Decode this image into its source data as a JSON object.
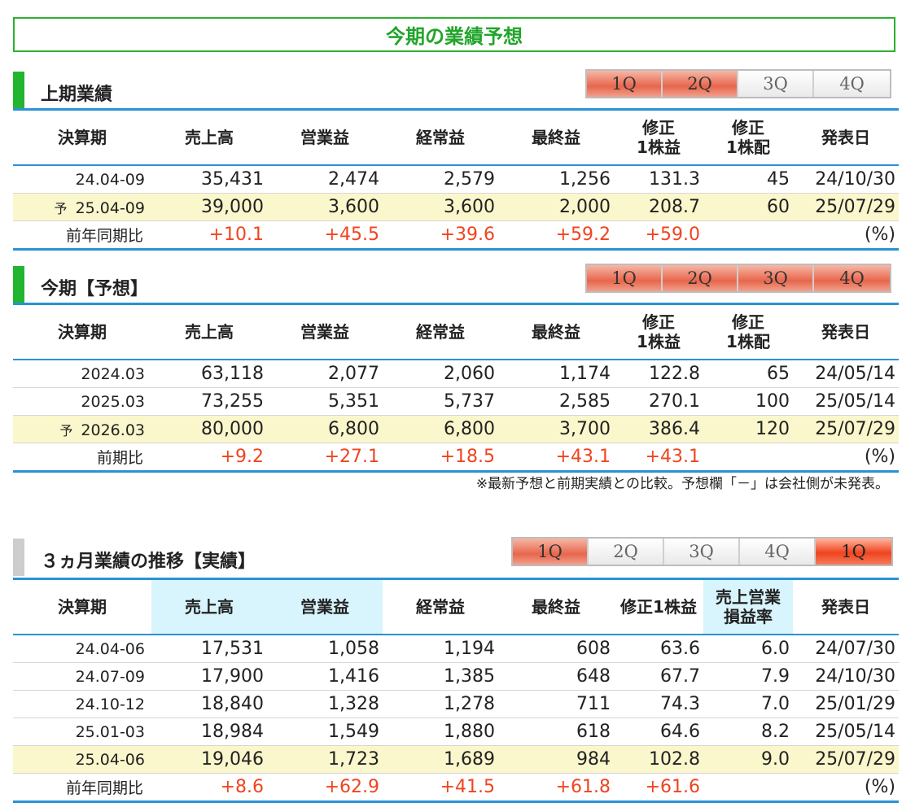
{
  "banner": "今期の業績予想",
  "first_half": {
    "title": "上期業績",
    "tabs": [
      "1Q",
      "2Q",
      "3Q",
      "4Q"
    ],
    "headers": [
      "決算期",
      "売上高",
      "営業益",
      "経常益",
      "最終益",
      "修正\n1株益",
      "修正\n1株配",
      "発表日"
    ],
    "rows": [
      {
        "period": "24.04-09",
        "forecast": false,
        "values": [
          "35,431",
          "2,474",
          "2,579",
          "1,256",
          "131.3",
          "45",
          "24/10/30"
        ]
      },
      {
        "period": "25.04-09",
        "forecast": true,
        "mark": "予",
        "values": [
          "39,000",
          "3,600",
          "3,600",
          "2,000",
          "208.7",
          "60",
          "25/07/29"
        ]
      }
    ],
    "compare": {
      "label": "前年同期比",
      "values": [
        "+10.1",
        "+45.5",
        "+39.6",
        "+59.2",
        "+59.0",
        "",
        "(%)"
      ]
    }
  },
  "full_year": {
    "title": "今期【予想】",
    "tabs": [
      "1Q",
      "2Q",
      "3Q",
      "4Q"
    ],
    "headers": [
      "決算期",
      "売上高",
      "営業益",
      "経常益",
      "最終益",
      "修正\n1株益",
      "修正\n1株配",
      "発表日"
    ],
    "rows": [
      {
        "period": "2024.03",
        "forecast": false,
        "values": [
          "63,118",
          "2,077",
          "2,060",
          "1,174",
          "122.8",
          "65",
          "24/05/14"
        ]
      },
      {
        "period": "2025.03",
        "forecast": false,
        "values": [
          "73,255",
          "5,351",
          "5,737",
          "2,585",
          "270.1",
          "100",
          "25/05/14"
        ]
      },
      {
        "period": "2026.03",
        "forecast": true,
        "mark": "予",
        "values": [
          "80,000",
          "6,800",
          "6,800",
          "3,700",
          "386.4",
          "120",
          "25/07/29"
        ]
      }
    ],
    "compare": {
      "label": "前期比",
      "values": [
        "+9.2",
        "+27.1",
        "+18.5",
        "+43.1",
        "+43.1",
        "",
        "(%)"
      ]
    },
    "note": "※最新予想と前期実績との比較。予想欄「－」は会社側が未発表。"
  },
  "quarterly": {
    "title": "３ヵ月業績の推移【実績】",
    "tabs": [
      "1Q",
      "2Q",
      "3Q",
      "4Q",
      "1Q"
    ],
    "headers": [
      "決算期",
      "売上高",
      "営業益",
      "経常益",
      "最終益",
      "修正1株益",
      "売上営業\n損益率",
      "発表日"
    ],
    "rows": [
      {
        "period": "24.04-06",
        "forecast": false,
        "values": [
          "17,531",
          "1,058",
          "1,194",
          "608",
          "63.6",
          "6.0",
          "24/07/30"
        ]
      },
      {
        "period": "24.07-09",
        "forecast": false,
        "values": [
          "17,900",
          "1,416",
          "1,385",
          "648",
          "67.7",
          "7.9",
          "24/10/30"
        ]
      },
      {
        "period": "24.10-12",
        "forecast": false,
        "values": [
          "18,840",
          "1,328",
          "1,278",
          "711",
          "74.3",
          "7.0",
          "25/01/29"
        ]
      },
      {
        "period": "25.01-03",
        "forecast": false,
        "values": [
          "18,984",
          "1,549",
          "1,880",
          "618",
          "64.6",
          "8.2",
          "25/05/14"
        ]
      },
      {
        "period": "25.04-06",
        "forecast": false,
        "highlight": true,
        "values": [
          "19,046",
          "1,723",
          "1,689",
          "984",
          "102.8",
          "9.0",
          "25/07/29"
        ]
      }
    ],
    "compare": {
      "label": "前年同期比",
      "values": [
        "+8.6",
        "+62.9",
        "+41.5",
        "+61.8",
        "+61.6",
        "",
        "(%)"
      ]
    }
  },
  "colors": {
    "accent_green": "#22b530",
    "table_border": "#2a92d6",
    "positive": "#f0441f",
    "forecast_row": "#fbf7cc",
    "header_highlight": "#d8f4fc"
  }
}
